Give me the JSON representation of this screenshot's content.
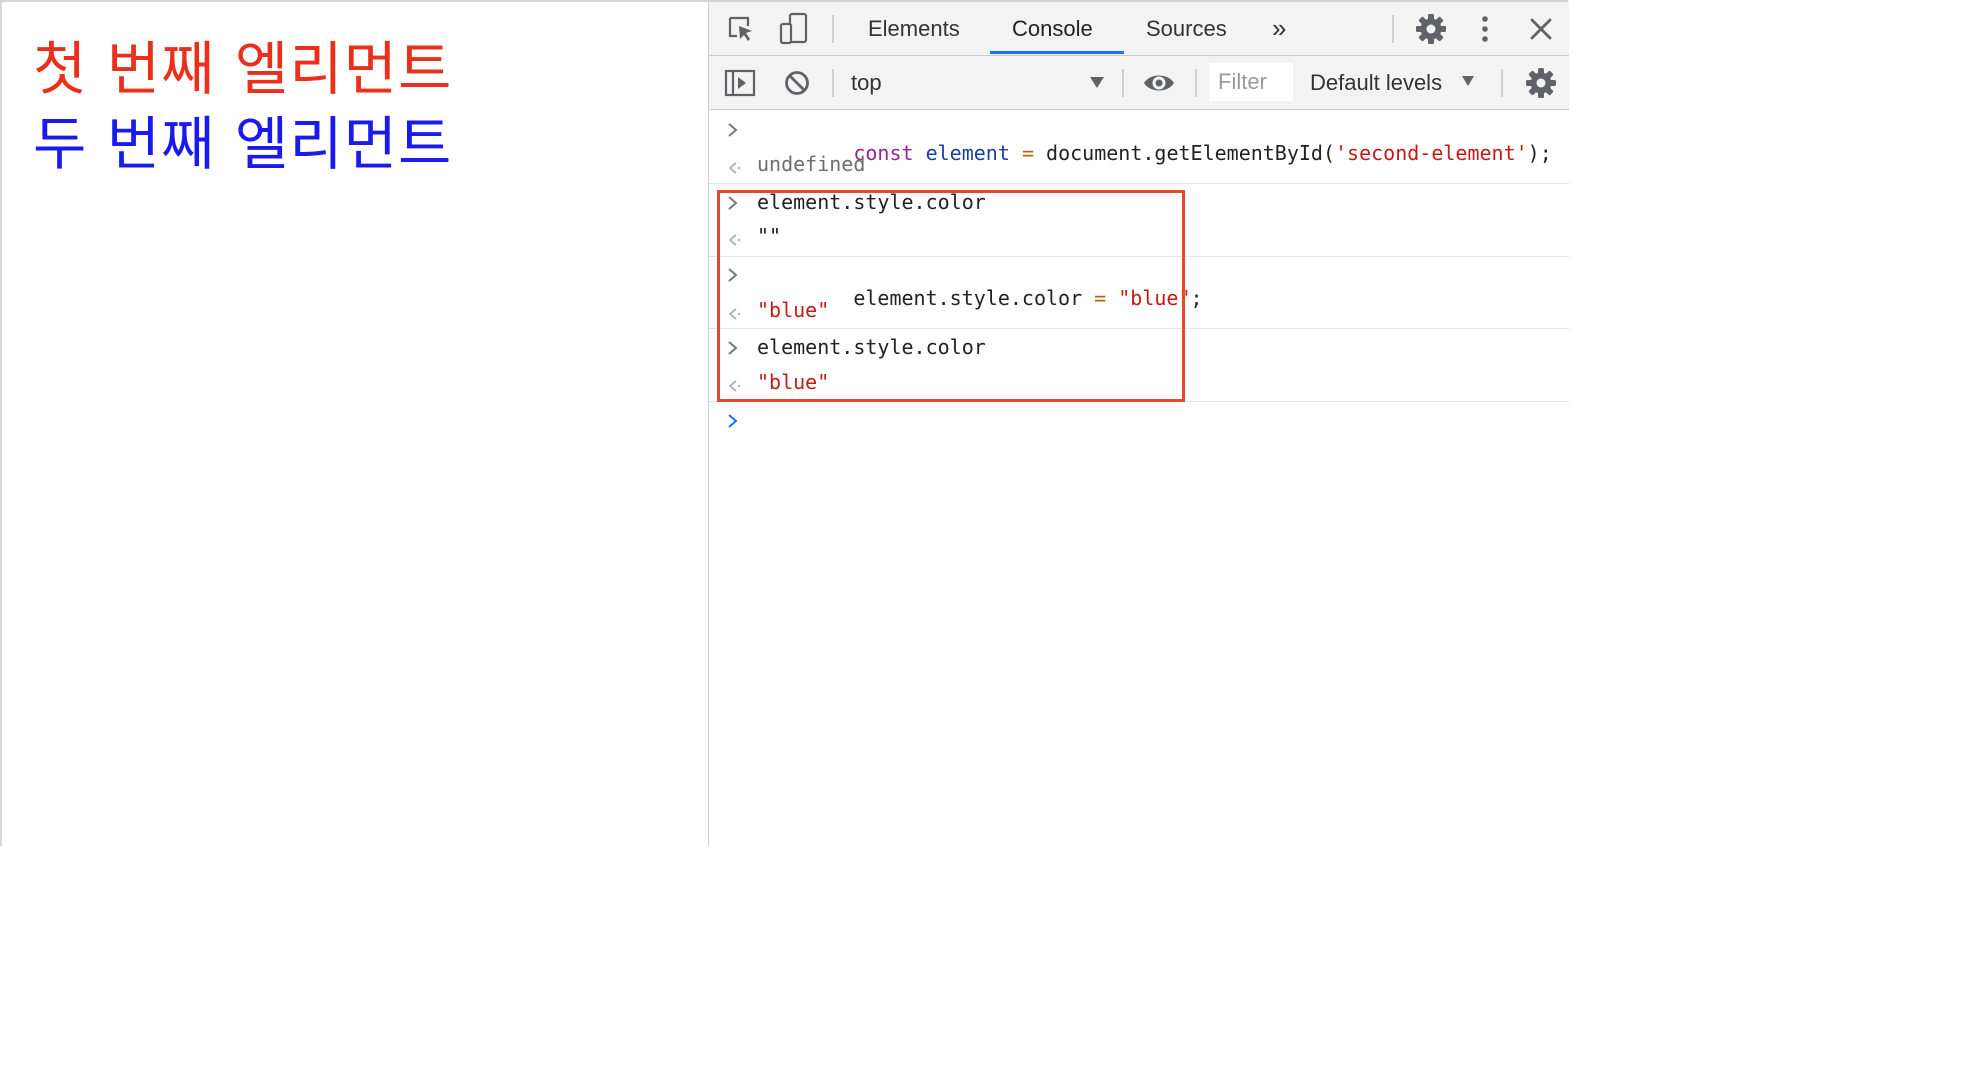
{
  "page": {
    "first_element_text": "첫 번째 엘리먼트",
    "second_element_text": "두 번째 엘리먼트",
    "first_color": "#e8301c",
    "second_color": "#1a1aee"
  },
  "devtools": {
    "tabs": [
      "Elements",
      "Console",
      "Sources"
    ],
    "active_tab": "Console",
    "more_tabs_symbol": "»",
    "context": "top",
    "filter_placeholder": "Filter",
    "log_levels": "Default levels",
    "colors": {
      "accent": "#1a73e8",
      "highlight_box": "#e8472e"
    }
  },
  "console": {
    "entries": [
      {
        "input_parts": [
          "const",
          " ",
          "element",
          " ",
          "=",
          " ",
          "document.getElementById(",
          "'second-element'",
          ");"
        ],
        "output": "undefined"
      },
      {
        "input": "element.style.color",
        "output": "\"\""
      },
      {
        "input_parts": [
          "element.style.color ",
          "=",
          " ",
          "\"blue\"",
          ";"
        ],
        "output": "\"blue\""
      },
      {
        "input": "element.style.color",
        "output": "\"blue\""
      }
    ]
  }
}
